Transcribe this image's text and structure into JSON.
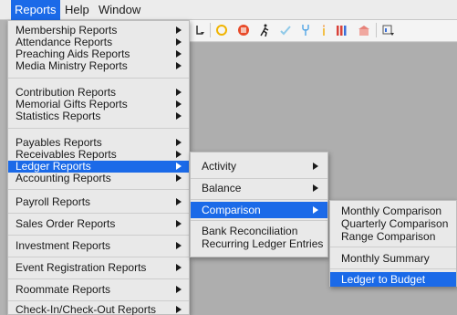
{
  "menubar": {
    "items": [
      "Reports",
      "Help",
      "Window"
    ]
  },
  "reports_menu": {
    "items": [
      "Membership Reports",
      "Attendance Reports",
      "Preaching Aids Reports",
      "Media Ministry Reports",
      "Contribution Reports",
      "Memorial Gifts Reports",
      "Statistics Reports",
      "Payables Reports",
      "Receivables Reports",
      "Ledger Reports",
      "Accounting Reports",
      "Payroll Reports",
      "Sales Order Reports",
      "Investment Reports",
      "Event Registration Reports",
      "Roommate Reports",
      "Check-In/Check-Out Reports"
    ]
  },
  "ledger_menu": {
    "items": [
      "Activity",
      "Balance",
      "Comparison",
      "Bank Reconciliation",
      "Recurring Ledger Entries"
    ]
  },
  "comparison_menu": {
    "items": [
      "Monthly Comparison",
      "Quarterly Comparison",
      "Range Comparison",
      "Monthly Summary",
      "Ledger to Budget"
    ]
  },
  "colors": {
    "highlight": "#1b6ae8",
    "menu_bg": "#e9e9e9",
    "workspace": "#aeaeae"
  }
}
